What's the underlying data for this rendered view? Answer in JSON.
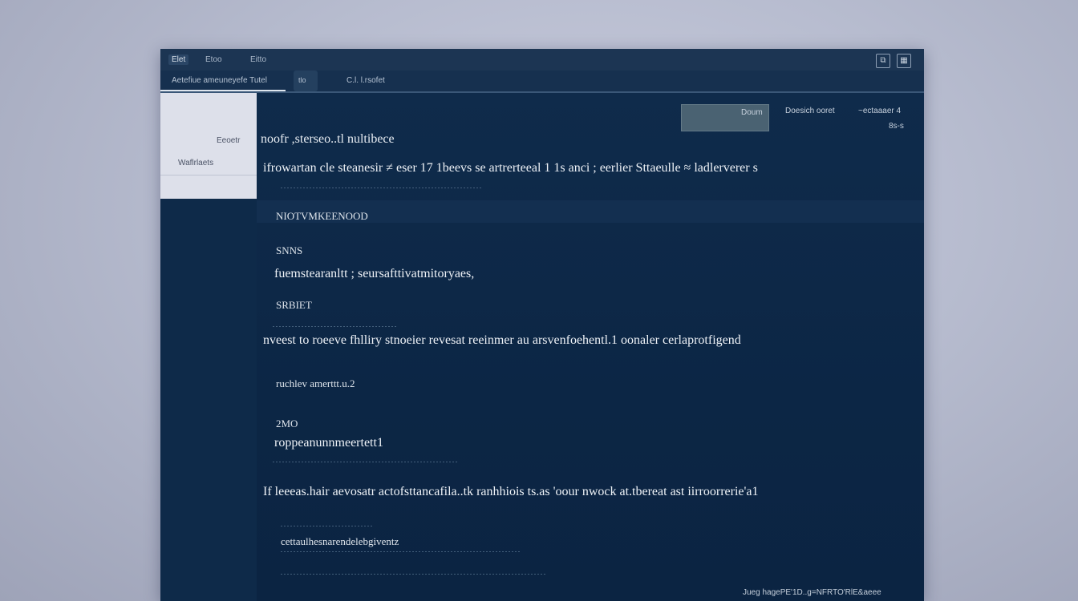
{
  "menubar": {
    "items": [
      "Elet",
      "Etoo",
      "Eitto"
    ]
  },
  "toolbar": {
    "tab_label": "Aetefiue ameuneyefe Tutel",
    "pill_label": "tlo",
    "title": "C.l. l.rsofet"
  },
  "sidebar": {
    "item1": "Eeoetr",
    "item2": "Waflrlaets"
  },
  "header": {
    "button_label": "Doum",
    "link_label": "Doesich ooret",
    "meta_line1": "~ectaaaer 4",
    "meta_line2": "8s-s"
  },
  "main": {
    "heading": "noofr ,sterseo..tl nultibece",
    "intro": "ifrowartan cle steanesir ≠ eser 17 1beevs se artrerteeal 1 1s anci ; eerlier Sttaeulle ≈ ladlerverer s",
    "section1_label": "NIOTVMKEENOOD",
    "section2_label": "SNNS",
    "section2_value": "fuemstearanltt ; seursafttivatmitoryaes,",
    "section3_label": "SRBIET",
    "section3_text": "nveest to roeeve fhlliry stnoeier revesat reeinmer au arsvenfoehentl.1 oonaler cerlaprotfigend",
    "section4_value": "ruchlev amerttt.u.2",
    "section5_label": "2MO",
    "section5_value": "roppeanunnmeertett1",
    "section6_text": "If leeeas.hair aevosatr actofsttancafila..tk ranhhiois ts.as 'oour nwock at.tbereat ast iirroorrerie'a1",
    "section7_value": "cettaulhesnarendelebgiventz"
  },
  "statusbar": {
    "text": "Jueg hagePE'1D..g=NFRTO'RlE&aeee"
  }
}
